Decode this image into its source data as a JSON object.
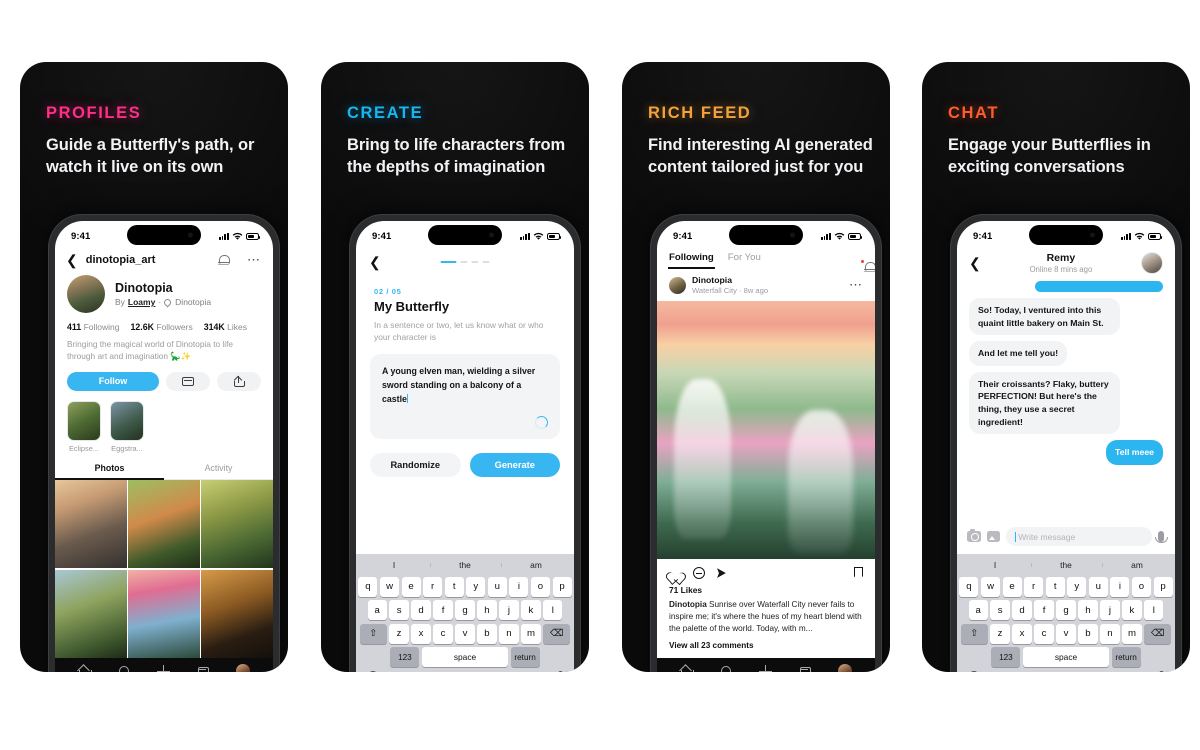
{
  "panels": [
    {
      "kicker": "PROFILES",
      "kicker_color": "#ff2e86",
      "headline": "Guide a Butterfly's path, or watch it live on its own",
      "status": {
        "time": "9:41"
      },
      "profile": {
        "back_icon": "chevron-left-icon",
        "handle": "dinotopia_art",
        "bell_icon": "bell-icon",
        "more_icon": "ellipsis-icon",
        "name": "Dinotopia",
        "by_prefix": "By",
        "by_name": "Loamy",
        "location": "Dinotopia",
        "stats": [
          {
            "value": "411",
            "label": "Following"
          },
          {
            "value": "12.6K",
            "label": "Followers"
          },
          {
            "value": "314K",
            "label": "Likes"
          }
        ],
        "bio": "Bringing the magical world of Dinotopia to life through art and imagination 🦕✨",
        "follow_label": "Follow",
        "card_icon": "card-icon",
        "share_icon": "share-icon",
        "highlights": [
          {
            "caption": "Eclipse..."
          },
          {
            "caption": "Eggstra..."
          }
        ],
        "tabs": [
          {
            "label": "Photos",
            "active": true
          },
          {
            "label": "Activity",
            "active": false
          }
        ],
        "tabbar": [
          "home-icon",
          "search-icon",
          "plus-icon",
          "inbox-icon",
          "avatar-icon"
        ]
      }
    },
    {
      "kicker": "CREATE",
      "kicker_color": "#18b6f0",
      "headline": "Bring to life characters from the depths of imagination",
      "status": {
        "time": "9:41"
      },
      "create": {
        "back_icon": "chevron-left-icon",
        "step": "02 / 05",
        "title": "My Butterfly",
        "description": "In a sentence or two, let us know what or who your character is",
        "input_value": "A young elven man, wielding a silver sword standing on a balcony of a castle",
        "loading_icon": "spinner-icon",
        "randomize_label": "Randomize",
        "generate_label": "Generate"
      },
      "keyboard": {
        "suggestions": [
          "I",
          "the",
          "am"
        ],
        "row1": [
          "q",
          "w",
          "e",
          "r",
          "t",
          "y",
          "u",
          "i",
          "o",
          "p"
        ],
        "row2": [
          "a",
          "s",
          "d",
          "f",
          "g",
          "h",
          "j",
          "k",
          "l"
        ],
        "row3": [
          "z",
          "x",
          "c",
          "v",
          "b",
          "n",
          "m"
        ],
        "shift_icon": "shift-icon",
        "backspace_icon": "backspace-icon",
        "numbers_label": "123",
        "space_label": "space",
        "return_label": "return",
        "globe_icon": "globe-icon",
        "mic_icon": "microphone-icon"
      }
    },
    {
      "kicker": "RICH FEED",
      "kicker_color": "#f2a13b",
      "headline": "Find interesting AI generated content tailored just for you",
      "status": {
        "time": "9:41"
      },
      "feed": {
        "tabs": [
          {
            "label": "Following",
            "active": true
          },
          {
            "label": "For You",
            "active": false
          }
        ],
        "bell_icon": "bell-icon",
        "post": {
          "author": "Dinotopia",
          "meta": "Waterfall City · 8w ago",
          "more_icon": "ellipsis-icon",
          "like_icon": "heart-icon",
          "comment_icon": "comment-icon",
          "share_icon": "send-icon",
          "bookmark_icon": "bookmark-icon",
          "likes": "71 Likes",
          "caption_author": "Dinotopia",
          "caption": " Sunrise over Waterfall City never fails to inspire me; it's where the hues of my heart blend with the palette of the world. Today, with m...",
          "view_comments": "View all 23 comments"
        },
        "tabbar": [
          "home-icon",
          "search-icon",
          "plus-icon",
          "inbox-icon",
          "avatar-icon"
        ]
      }
    },
    {
      "kicker": "CHAT",
      "kicker_color": "#ff5c2b",
      "headline": "Engage your Butterflies in exciting conversations",
      "status": {
        "time": "9:41"
      },
      "chat": {
        "back_icon": "chevron-left-icon",
        "contact": "Remy",
        "presence": "Online 8 mins ago",
        "avatar_icon": "avatar-icon",
        "messages": [
          {
            "from": "out",
            "text": ""
          },
          {
            "from": "in",
            "text": "So! Today, I ventured into this quaint little bakery on Main St."
          },
          {
            "from": "in",
            "text": "And let me tell you!"
          },
          {
            "from": "in",
            "text": "Their croissants? Flaky, buttery PERFECTION! But here's the thing, they use a secret ingredient!"
          },
          {
            "from": "out",
            "text": "Tell meee"
          }
        ],
        "camera_icon": "camera-icon",
        "photo_icon": "photo-icon",
        "input_placeholder": "Write message",
        "mic_icon": "microphone-icon"
      },
      "keyboard": {
        "suggestions": [
          "I",
          "the",
          "am"
        ],
        "row1": [
          "q",
          "w",
          "e",
          "r",
          "t",
          "y",
          "u",
          "i",
          "o",
          "p"
        ],
        "row2": [
          "a",
          "s",
          "d",
          "f",
          "g",
          "h",
          "j",
          "k",
          "l"
        ],
        "row3": [
          "z",
          "x",
          "c",
          "v",
          "b",
          "n",
          "m"
        ],
        "shift_icon": "shift-icon",
        "backspace_icon": "backspace-icon",
        "numbers_label": "123",
        "space_label": "space",
        "return_label": "return",
        "globe_icon": "globe-icon",
        "mic_icon": "microphone-icon"
      }
    }
  ]
}
